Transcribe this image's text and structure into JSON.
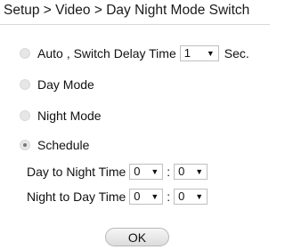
{
  "header": {
    "breadcrumb": "Setup > Video > Day Night Mode Switch"
  },
  "modes": {
    "auto": {
      "label": "Auto",
      "switch_delay_label": ", Switch Delay Time",
      "delay_value": "1",
      "delay_unit": "Sec."
    },
    "day_mode": {
      "label": "Day Mode"
    },
    "night_mode": {
      "label": "Night Mode"
    },
    "schedule": {
      "label": "Schedule",
      "selected": true,
      "day_to_night": {
        "label": "Day to Night Time",
        "hour": "0",
        "minute": "0"
      },
      "night_to_day": {
        "label": "Night to Day Time",
        "hour": "0",
        "minute": "0"
      },
      "time_separator": ":"
    }
  },
  "actions": {
    "ok_label": "OK"
  },
  "icons": {
    "dropdown": "chevron-down-icon",
    "arrow_glyph": "▼"
  }
}
